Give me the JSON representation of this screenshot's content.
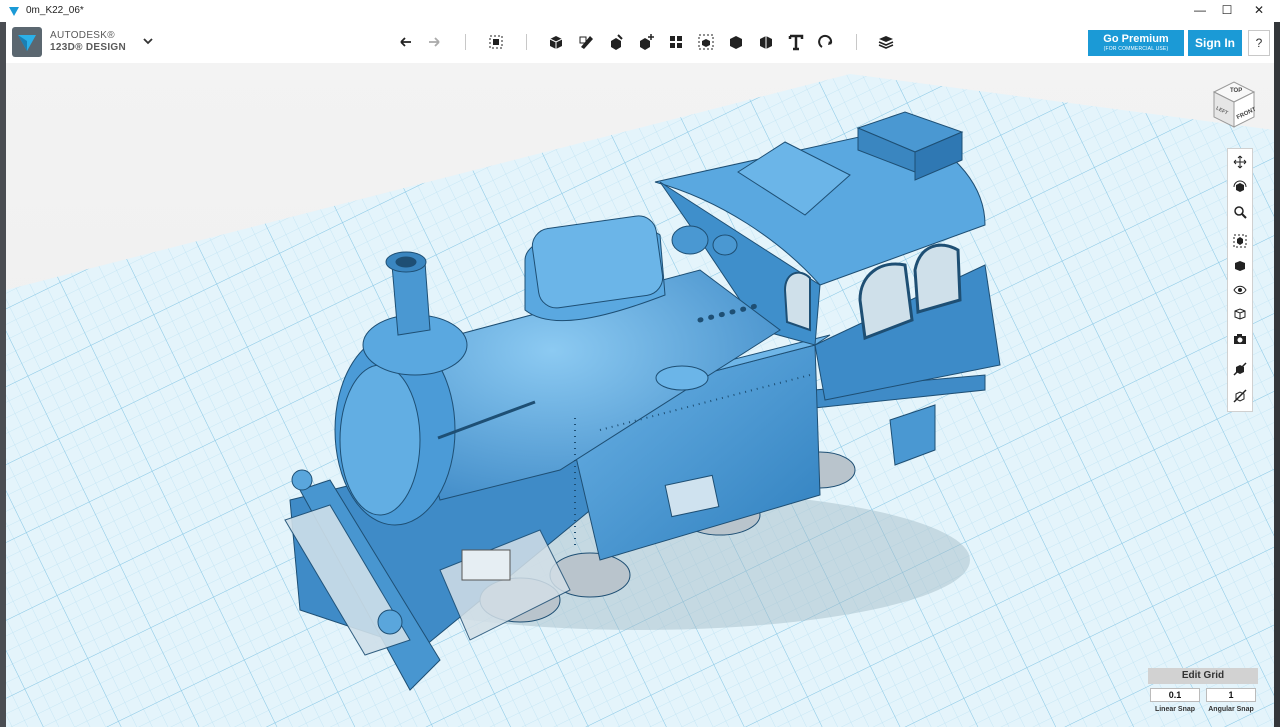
{
  "window": {
    "title": "0m_K22_06*",
    "minimize": "—",
    "maximize": "☐",
    "close": "✕"
  },
  "brand": {
    "line1": "AUTODESK®",
    "line2": "123D® DESIGN"
  },
  "toolbar": {
    "icons": [
      "undo-icon",
      "redo-icon",
      "transform-icon",
      "primitives-icon",
      "sketch-icon",
      "construct-icon",
      "modify-icon",
      "pattern-icon",
      "grouping-icon",
      "combine-icon",
      "measure-icon",
      "text-icon",
      "snap-icon",
      "material-icon"
    ]
  },
  "account": {
    "premium_label": "Go Premium",
    "premium_sub": "(FOR COMMERCIAL USE)",
    "signin_label": "Sign In",
    "help_label": "?"
  },
  "viewcube": {
    "top": "TOP",
    "front": "FRONT",
    "left": "LEFT"
  },
  "navbar": {
    "icons": [
      "pan-icon",
      "orbit-icon",
      "zoom-icon",
      "fit-icon",
      "view-icon",
      "visibility-icon",
      "materials-outline-icon",
      "screenshot-icon",
      "hide-icon",
      "clear-icon"
    ]
  },
  "grid": {
    "edit_label": "Edit Grid",
    "linear_value": "0.1",
    "angular_value": "1",
    "linear_label": "Linear Snap",
    "angular_label": "Angular Snap"
  },
  "colors": {
    "accent": "#1b9ad6",
    "model": "#4a9bd6",
    "grid": "#c9e9f6"
  }
}
